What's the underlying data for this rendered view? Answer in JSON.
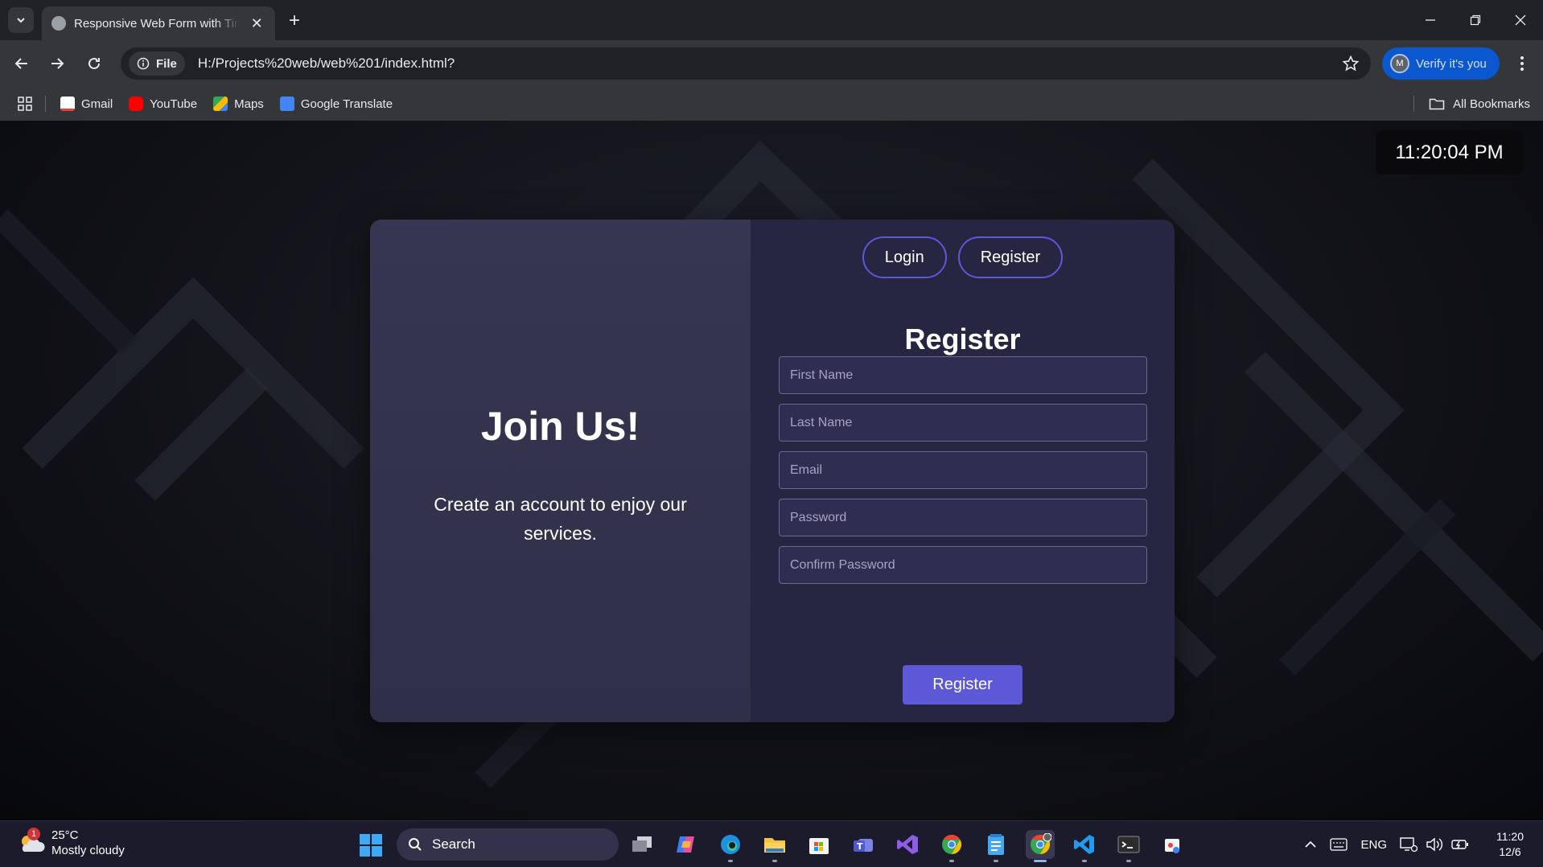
{
  "browser": {
    "tab_title": "Responsive Web Form with Tim",
    "url": "H:/Projects%20web/web%201/index.html?",
    "site_label": "File",
    "verify_label": "Verify it's you",
    "avatar_initial": "M",
    "bookmarks": [
      {
        "label": "Gmail",
        "color": "#ea4335"
      },
      {
        "label": "YouTube",
        "color": "#ff0000"
      },
      {
        "label": "Maps",
        "color": "#34a853"
      },
      {
        "label": "Google Translate",
        "color": "#4285f4"
      }
    ],
    "all_bookmarks": "All Bookmarks"
  },
  "page": {
    "clock": "11:20:04 PM",
    "left": {
      "title": "Join Us!",
      "text": "Create an account to enjoy our services."
    },
    "toggle": {
      "login": "Login",
      "register": "Register"
    },
    "form": {
      "title": "Register",
      "fields": [
        {
          "placeholder": "First Name"
        },
        {
          "placeholder": "Last Name"
        },
        {
          "placeholder": "Email"
        },
        {
          "placeholder": "Password"
        },
        {
          "placeholder": "Confirm Password"
        }
      ],
      "submit": "Register"
    },
    "accent_color": "#5c58d6"
  },
  "taskbar": {
    "weather": {
      "temp": "25°C",
      "desc": "Mostly cloudy",
      "badge": "1"
    },
    "search": "Search",
    "apps": [
      "task-view",
      "copilot",
      "edge",
      "file-explorer",
      "microsoft-store",
      "teams",
      "visual-studio",
      "chrome",
      "notepad",
      "chrome-profile",
      "vscode",
      "terminal",
      "snipping-tool"
    ],
    "language": "ENG",
    "time": "11:20",
    "date": "12/6"
  }
}
